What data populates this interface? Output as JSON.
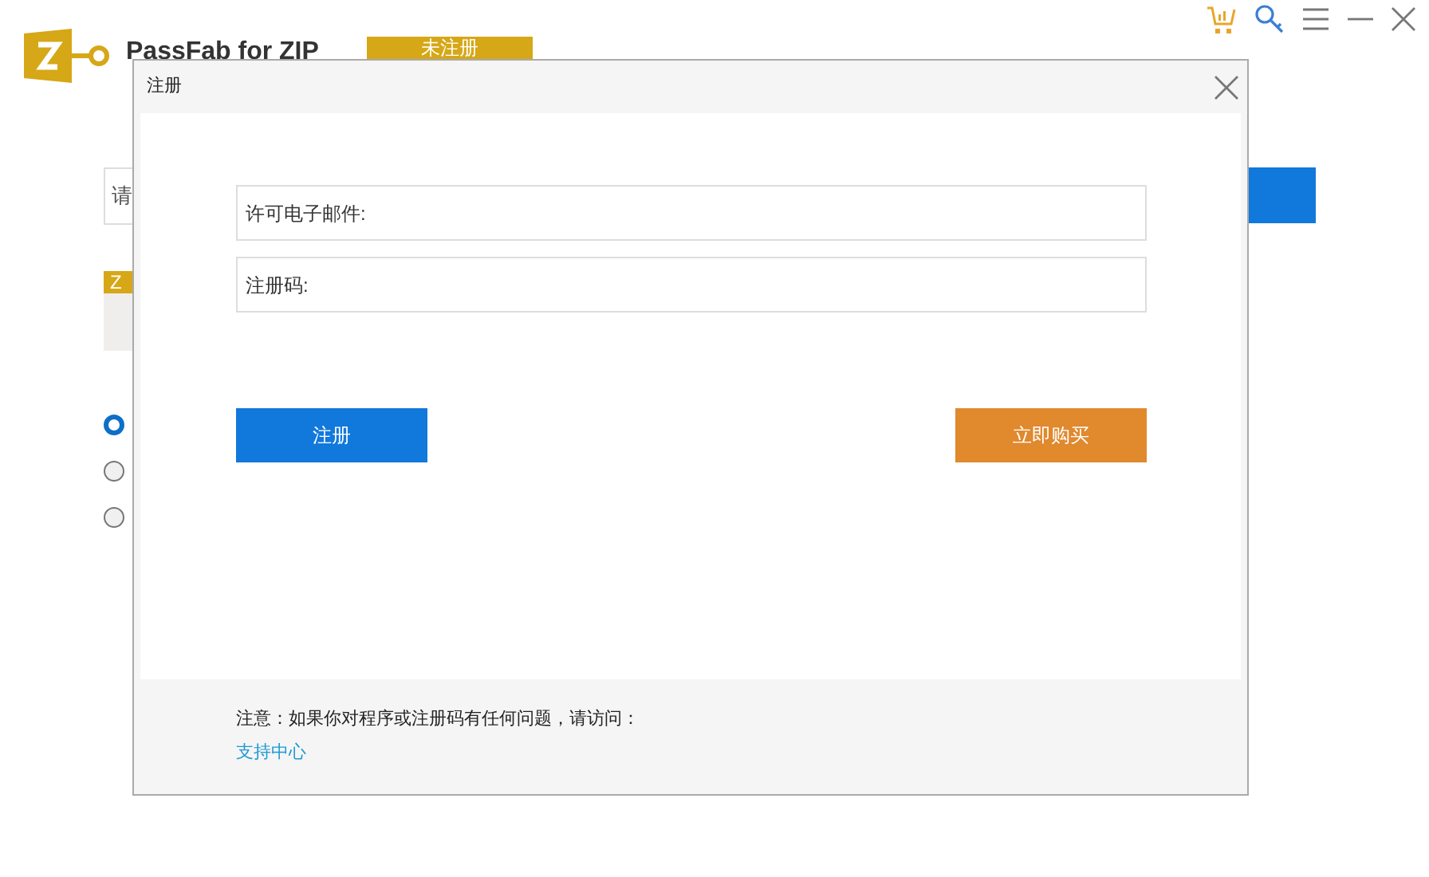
{
  "app": {
    "title": "PassFab for ZIP",
    "badge": "未注册"
  },
  "background": {
    "input_fragment": "请",
    "tab_fragment": "Z",
    "radios": [
      {
        "selected": true
      },
      {
        "selected": false
      },
      {
        "selected": false
      }
    ]
  },
  "dialog": {
    "title": "注册",
    "fields": [
      {
        "placeholder": "许可电子邮件:"
      },
      {
        "placeholder": "注册码:"
      }
    ],
    "buttons": [
      {
        "label": "注册",
        "kind": "primary"
      },
      {
        "label": "立即购买",
        "kind": "buy"
      }
    ],
    "note": "注意：如果你对程序或注册码有任何问题，请访问：",
    "link": "支持中心"
  }
}
